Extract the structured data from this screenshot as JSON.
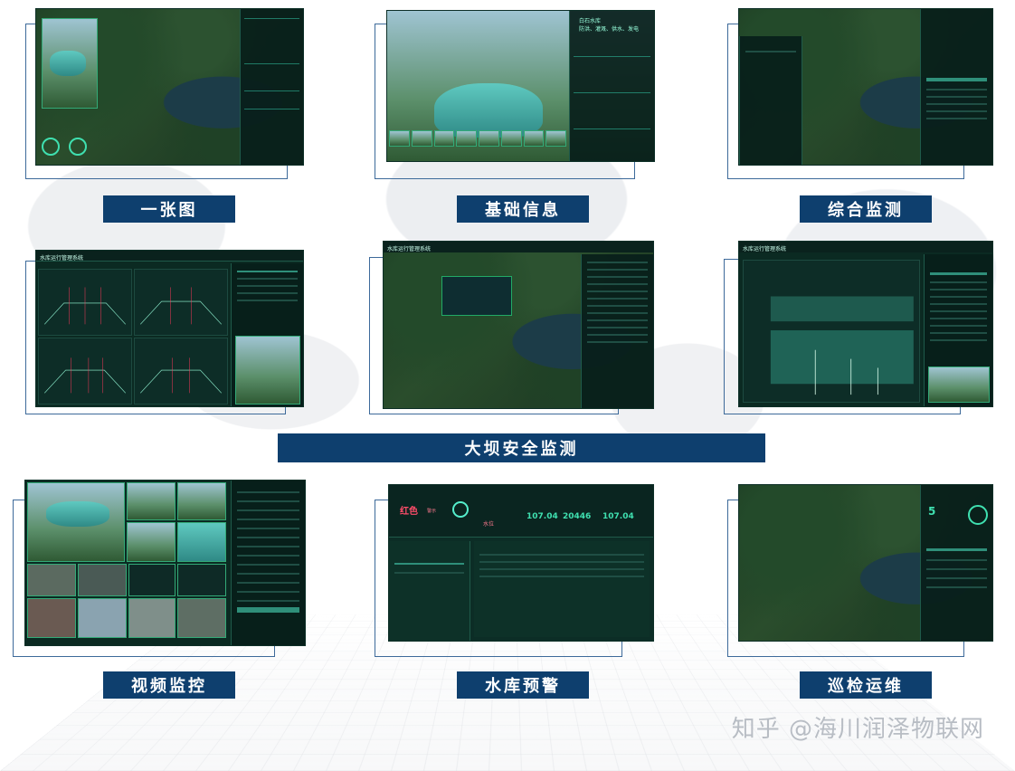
{
  "modules": {
    "map": "一张图",
    "basic_info": "基础信息",
    "integrated_monitoring": "综合监测",
    "dam_safety": "大坝安全监测",
    "video": "视频监控",
    "warning": "水库预警",
    "inspection": "巡检运维"
  },
  "screens": {
    "system_title": "水库运行管理系统",
    "reservoir_name": "白石水库",
    "reservoir_functions": "防洪、灌溉、供水、发电",
    "warning_level": "红色",
    "warning_sub": "警示",
    "water_level_label": "水位",
    "water_level_value": "107.04",
    "storage_value": "20446",
    "inflow_value": "107.04",
    "inspection_count": "5"
  },
  "watermark": "知乎 @海川润泽物联网",
  "colors": {
    "label_bg": "#0e3f6e",
    "frame_line": "#3d6a9a",
    "screen_bg": "#0b2a22",
    "accent": "#3fe0b0"
  }
}
